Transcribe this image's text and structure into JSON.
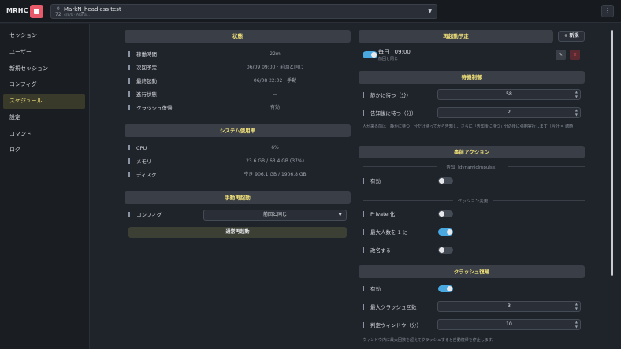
{
  "app": {
    "brand": "MRHC"
  },
  "session": {
    "num_top": "0",
    "num_bottom": "72",
    "name": "MarkN_headless test",
    "meta": "4/8/0 · Alpha..."
  },
  "sidebar": {
    "items": [
      {
        "label": "セッション"
      },
      {
        "label": "ユーザー"
      },
      {
        "label": "新規セッション"
      },
      {
        "label": "コンフィグ"
      },
      {
        "label": "スケジュール"
      },
      {
        "label": "設定"
      },
      {
        "label": "コマンド"
      },
      {
        "label": "ログ"
      }
    ]
  },
  "status": {
    "title": "状態",
    "rows": [
      {
        "label": "稼働時間",
        "value": "22m"
      },
      {
        "label": "次回予定",
        "value": "06/09 09:00 · 前回と同じ"
      },
      {
        "label": "最終起動",
        "value": "06/08 22:02 · 手動"
      },
      {
        "label": "進行状態",
        "value": "—"
      },
      {
        "label": "クラッシュ復帰",
        "value": "有効"
      }
    ]
  },
  "system": {
    "title": "システム使用率",
    "rows": [
      {
        "label": "CPU",
        "value": "6%"
      },
      {
        "label": "メモリ",
        "value": "23.6 GB / 63.4 GB (37%)"
      },
      {
        "label": "ディスク",
        "value": "空き 906.1 GB / 1906.8 GB"
      }
    ]
  },
  "manual": {
    "title": "手動再起動",
    "config_label": "コンフィグ",
    "config_value": "前回と同じ",
    "restart_button": "通常再起動"
  },
  "schedule": {
    "title": "再起動予定",
    "new_button": "+ 新規",
    "entry_time": "毎日 · 09:00",
    "entry_sub": "前回と同じ",
    "edit_icon": "✎",
    "delete_icon": "×"
  },
  "standby": {
    "title": "待機制御",
    "wait_label": "静かに待つ（分）",
    "wait_value": "58",
    "notice_label": "告知後に待つ（分）",
    "notice_value": "2",
    "note": "人が来る前は「静かに待つ」分だけ待ってから告知し、さらに「告知後に待つ」分の後に強制実行します（合計 = 總時"
  },
  "pre_action": {
    "title": "事前アクション",
    "notice_sub": "告知（dynamicImpulse）",
    "enabled_label": "有効",
    "session_sub": "セッション変更",
    "private_label": "Private 化",
    "max_users_label": "最大人数を 1 に",
    "rename_label": "改名する"
  },
  "crash": {
    "title": "クラッシュ復帰",
    "enabled_label": "有効",
    "max_label": "最大クラッシュ回数",
    "max_value": "3",
    "window_label": "判定ウィンドウ（分）",
    "window_value": "10",
    "note": "ウィンドウ内に最大回数を超えてクラッシュすると自動復帰を停止します。"
  },
  "colors": {
    "accent": "#f0e07a",
    "toggle_on": "#4aa8e0",
    "stop": "#e85a6a"
  }
}
